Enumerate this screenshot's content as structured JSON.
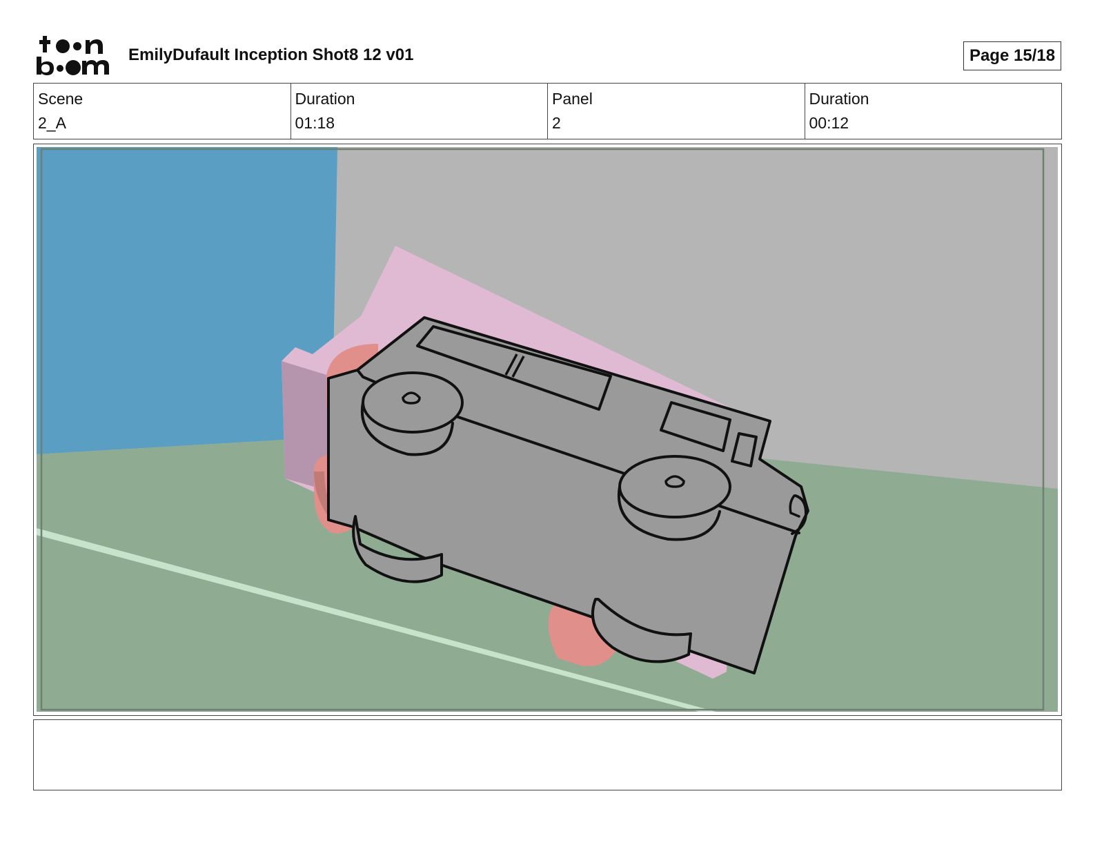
{
  "header": {
    "logo_text": "toon boom",
    "title": "EmilyDufault Inception Shot8 12 v01",
    "page": "Page 15/18"
  },
  "info": {
    "scene_label": "Scene",
    "scene_value": "2_A",
    "scene_duration_label": "Duration",
    "scene_duration_value": "01:18",
    "panel_label": "Panel",
    "panel_value": "2",
    "panel_duration_label": "Duration",
    "panel_duration_value": "00:12"
  },
  "panel": {
    "colors": {
      "wall_blue": "#5a9ec4",
      "wall_gray": "#b5b5b5",
      "ground_green": "#8fac93",
      "road_line": "#c8e3cc",
      "block_pink": "#dfbad2",
      "block_pink_shadow": "#b595ad",
      "tire_red": "#e08f8a",
      "tire_red_shadow": "#c27a76",
      "truck_body": "#9a9a9a",
      "outline": "#111111"
    }
  },
  "notes": {
    "text": ""
  }
}
